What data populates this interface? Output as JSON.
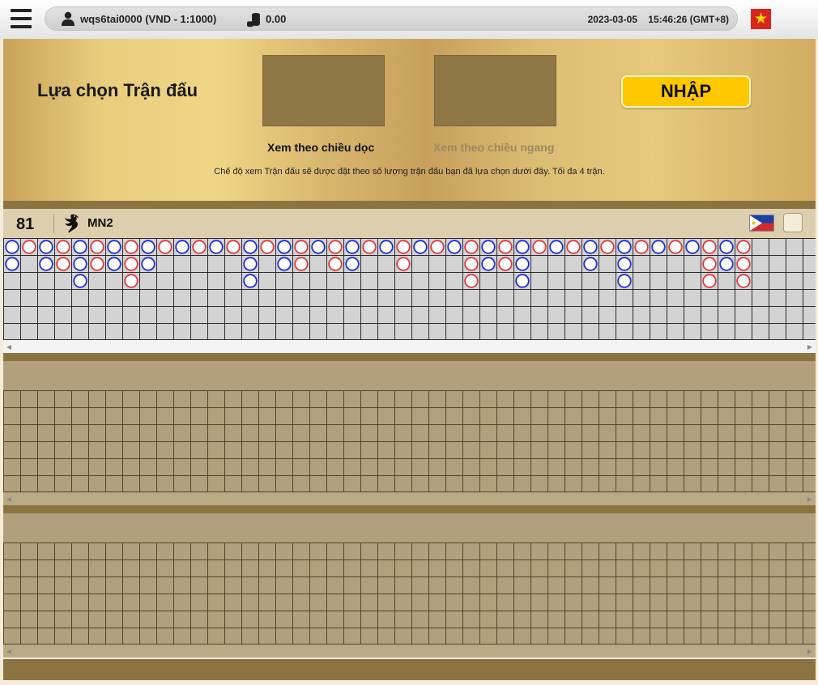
{
  "header": {
    "user": "wqs6tai0000 (VND - 1:1000)",
    "balance": "0.00",
    "date": "2023-03-05",
    "time": "15:46:26 (GMT+8)"
  },
  "banner": {
    "title": "Lựa chọn Trận đấu",
    "view_vertical": "Xem theo chiều dọc",
    "view_horizontal": "Xem theo chiều ngang",
    "note": "Chế độ xem Trận đấu sẽ được đặt theo số lượng trận đấu bạn đã lựa chọn dưới đây. Tối đa 4 trận.",
    "enter_button": "NHẬP"
  },
  "table": {
    "number": "81",
    "name": "MN2"
  },
  "colors": {
    "blue": "#1f2fd6",
    "red": "#e0393c",
    "accent": "#ffc800"
  },
  "road": {
    "rows": 6,
    "cols": 48,
    "columns": [
      [
        "B",
        "B"
      ],
      [
        "R"
      ],
      [
        "B",
        "B"
      ],
      [
        "R",
        "R"
      ],
      [
        "B",
        "B",
        "B"
      ],
      [
        "R",
        "R"
      ],
      [
        "B",
        "B"
      ],
      [
        "R",
        "R",
        "R"
      ],
      [
        "B",
        "B"
      ],
      [
        "R"
      ],
      [
        "B"
      ],
      [
        "R"
      ],
      [
        "B"
      ],
      [
        "R"
      ],
      [
        "B",
        "B",
        "B"
      ],
      [
        "R"
      ],
      [
        "B",
        "B"
      ],
      [
        "R",
        "R"
      ],
      [
        "B"
      ],
      [
        "R",
        "R"
      ],
      [
        "B",
        "B"
      ],
      [
        "R"
      ],
      [
        "B"
      ],
      [
        "R",
        "R"
      ],
      [
        "B"
      ],
      [
        "R"
      ],
      [
        "B"
      ],
      [
        "R",
        "R",
        "R"
      ],
      [
        "B",
        "B"
      ],
      [
        "R",
        "R"
      ],
      [
        "B",
        "B",
        "B"
      ],
      [
        "R"
      ],
      [
        "B"
      ],
      [
        "R"
      ],
      [
        "B",
        "B"
      ],
      [
        "R"
      ],
      [
        "B",
        "B",
        "B"
      ],
      [
        "R"
      ],
      [
        "B"
      ],
      [
        "R"
      ],
      [
        "B"
      ],
      [
        "R",
        "R",
        "R"
      ],
      [
        "B",
        "B"
      ],
      [
        "R",
        "R",
        "R"
      ]
    ]
  }
}
